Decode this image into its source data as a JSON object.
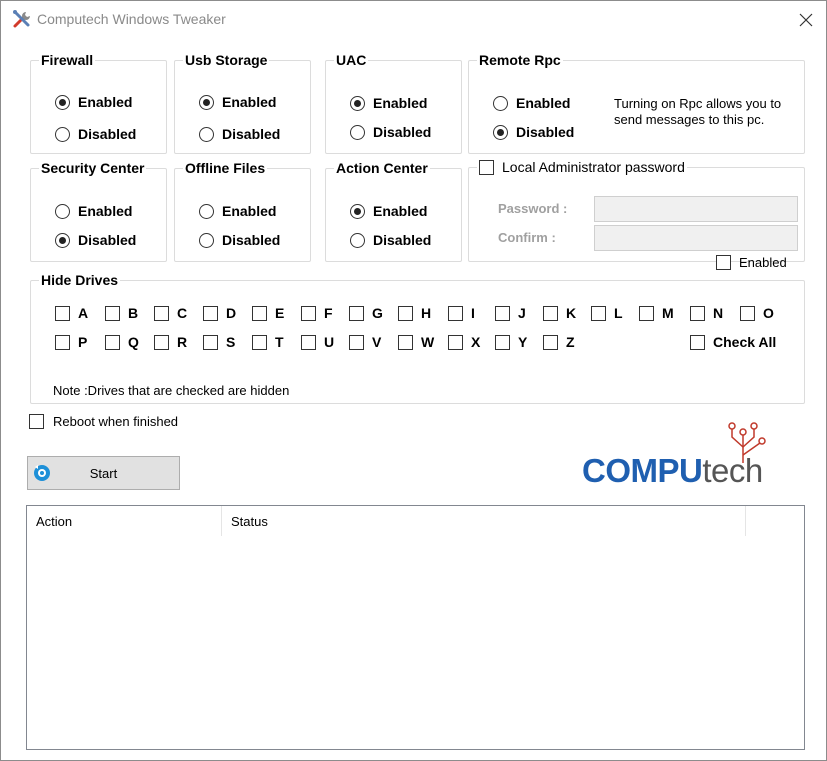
{
  "window": {
    "title": "Computech Windows Tweaker",
    "app_icon": "tools-icon",
    "close_icon": "close-icon"
  },
  "groups": {
    "firewall": {
      "title": "Firewall",
      "options": [
        "Enabled",
        "Disabled"
      ],
      "selected": "Enabled"
    },
    "usb_storage": {
      "title": "Usb Storage",
      "options": [
        "Enabled",
        "Disabled"
      ],
      "selected": "Enabled"
    },
    "uac": {
      "title": "UAC",
      "options": [
        "Enabled",
        "Disabled"
      ],
      "selected": "Enabled"
    },
    "remote_rpc": {
      "title": "Remote Rpc",
      "options": [
        "Enabled",
        "Disabled"
      ],
      "selected": "Disabled",
      "note": "Turning on Rpc allows you to send messages to this pc."
    },
    "security_center": {
      "title": "Security Center",
      "options": [
        "Enabled",
        "Disabled"
      ],
      "selected": "Disabled"
    },
    "offline_files": {
      "title": "Offline Files",
      "options": [
        "Enabled",
        "Disabled"
      ],
      "selected": "Disabled"
    },
    "action_center": {
      "title": "Action Center",
      "options": [
        "Enabled",
        "Disabled"
      ],
      "selected": "Enabled"
    }
  },
  "admin": {
    "title": "Local Administrator password",
    "checked": false,
    "password_label": "Password :",
    "password_value": "",
    "confirm_label": "Confirm  :",
    "confirm_value": "",
    "enabled_label": "Enabled",
    "enabled_checked": false
  },
  "hide_drives": {
    "title": "Hide Drives",
    "row1": [
      "A",
      "B",
      "C",
      "D",
      "E",
      "F",
      "G",
      "H",
      "I",
      "J",
      "K",
      "L",
      "M",
      "N",
      "O"
    ],
    "row2": [
      "P",
      "Q",
      "R",
      "S",
      "T",
      "U",
      "V",
      "W",
      "X",
      "Y",
      "Z"
    ],
    "check_all": "Check All",
    "note": "Note :Drives that are checked are hidden"
  },
  "reboot": {
    "label": "Reboot when finished",
    "checked": false
  },
  "start": {
    "label": "Start",
    "icon": "gear-refresh-icon"
  },
  "logo": {
    "part1": "COMPU",
    "part2": "tech",
    "brand_blue": "#1f5fb0",
    "brand_red": "#c0392b"
  },
  "list": {
    "columns": [
      "Action",
      "Status"
    ]
  }
}
